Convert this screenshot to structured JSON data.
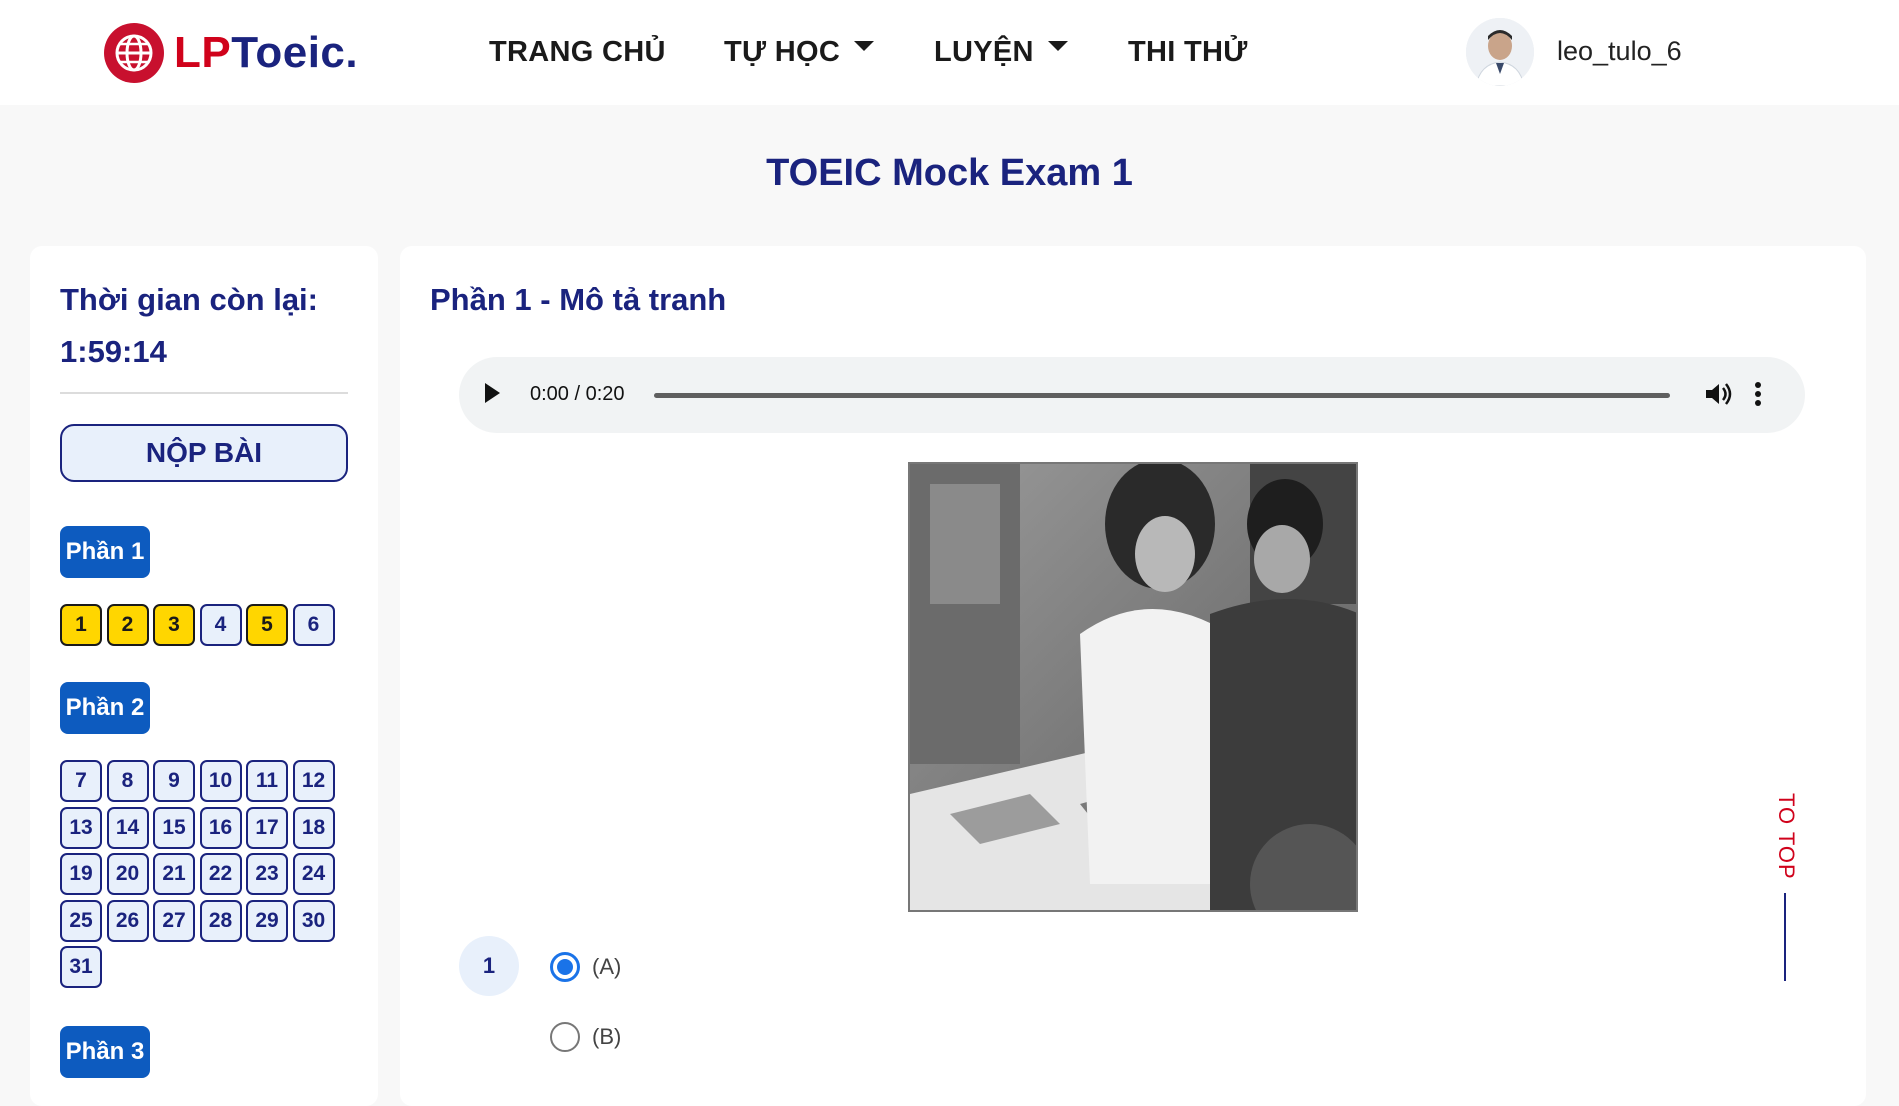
{
  "header": {
    "logo": {
      "prefix": "LP",
      "suffix": "Toeic."
    },
    "nav": [
      {
        "label": "TRANG CHỦ",
        "has_dropdown": false
      },
      {
        "label": "TỰ HỌC",
        "has_dropdown": true
      },
      {
        "label": "LUYỆN",
        "has_dropdown": true
      },
      {
        "label": "THI THỬ",
        "has_dropdown": false
      }
    ],
    "username": "leo_tulo_6"
  },
  "page_title": "TOEIC Mock Exam 1",
  "sidebar": {
    "time_label": "Thời gian còn lại:",
    "time_value": "1:59:14",
    "submit_label": "NỘP BÀI",
    "parts": [
      {
        "label": "Phần 1",
        "questions": [
          "1",
          "2",
          "3",
          "4",
          "5",
          "6"
        ],
        "answered": [
          "1",
          "2",
          "3",
          "5"
        ]
      },
      {
        "label": "Phần 2",
        "questions": [
          "7",
          "8",
          "9",
          "10",
          "11",
          "12",
          "13",
          "14",
          "15",
          "16",
          "17",
          "18",
          "19",
          "20",
          "21",
          "22",
          "23",
          "24",
          "25",
          "26",
          "27",
          "28",
          "29",
          "30",
          "31"
        ],
        "answered": []
      },
      {
        "label": "Phần 3",
        "questions": [],
        "answered": []
      }
    ]
  },
  "main": {
    "section_title": "Phần 1 - Mô tả tranh",
    "audio": {
      "time": "0:00 / 0:20",
      "progress": 0
    },
    "question": {
      "number": "1",
      "options": [
        {
          "label": "(A)",
          "checked": true
        },
        {
          "label": "(B)",
          "checked": false
        }
      ]
    }
  },
  "to_top_label": "TO TOP",
  "colors": {
    "brand_red": "#d0021b",
    "brand_navy": "#1a237e",
    "part_button_blue": "#0d5bbf",
    "answered_yellow": "#ffd600",
    "radio_blue": "#1a73e8"
  },
  "icons": [
    "globe-icon",
    "caret-down-icon",
    "play-icon",
    "volume-icon",
    "more-vertical-icon"
  ]
}
